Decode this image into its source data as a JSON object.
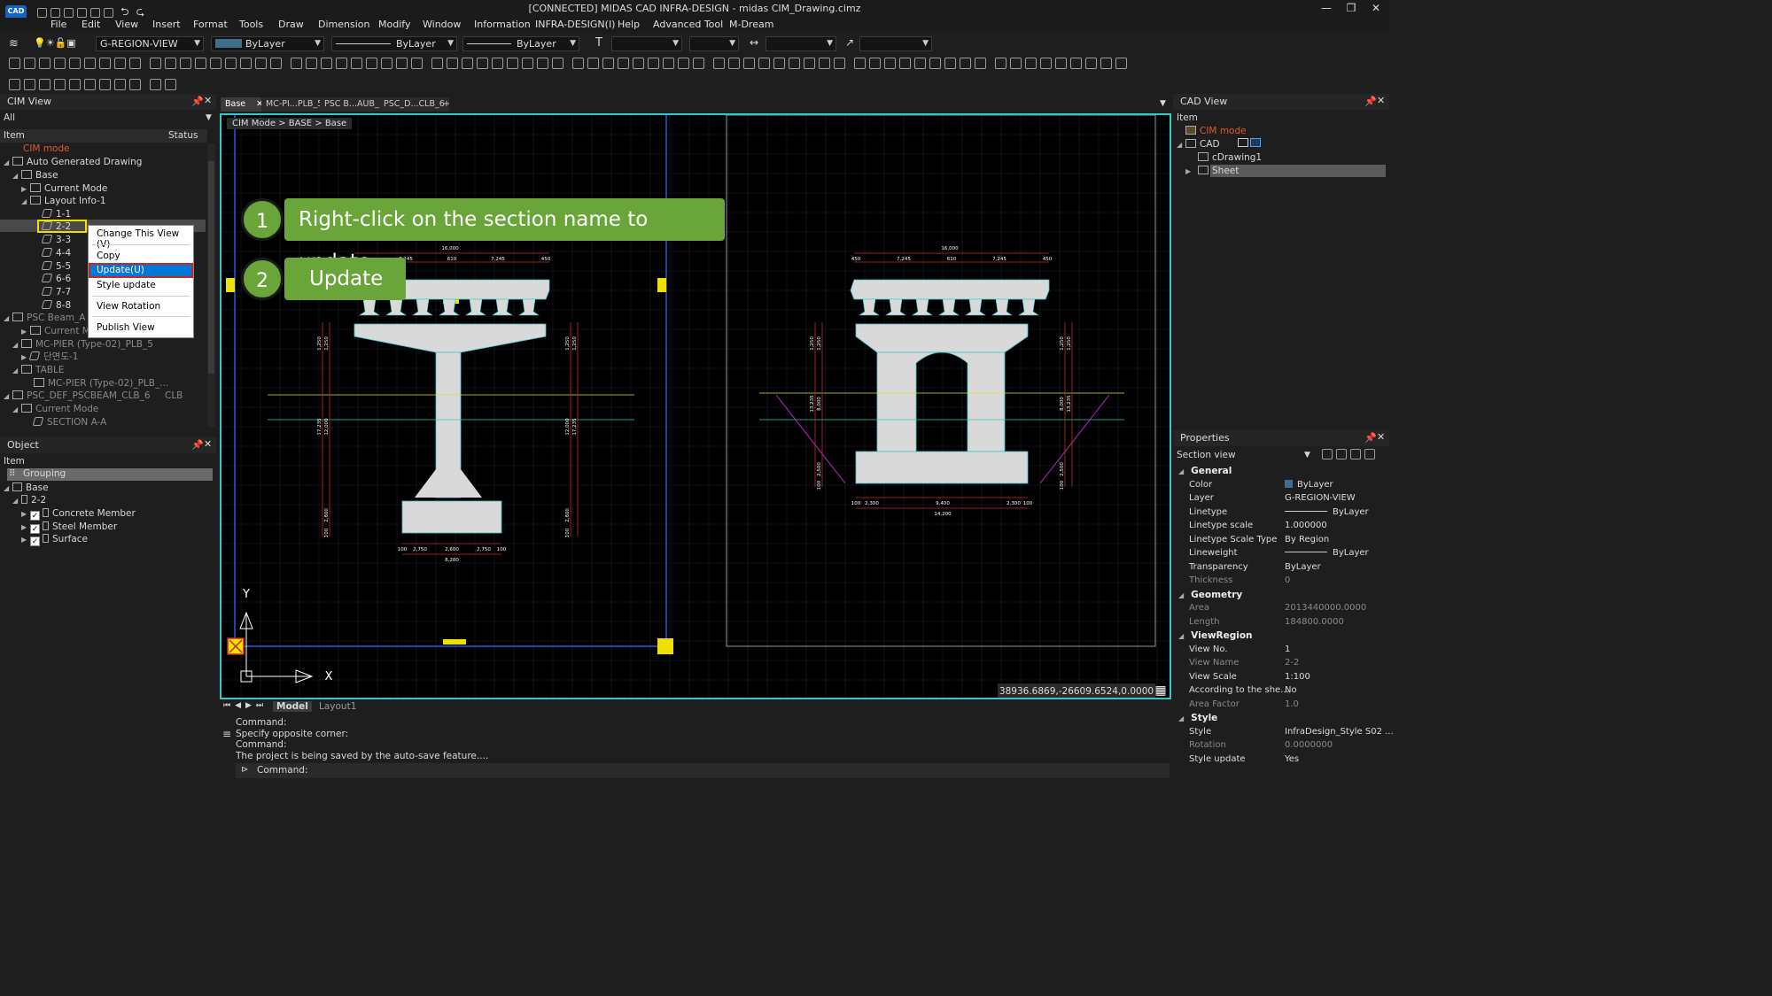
{
  "app": {
    "title": "[CONNECTED] MIDAS CAD INFRA-DESIGN - midas CIM_Drawing.cimz",
    "logo_text": "CAD",
    "window_controls": [
      "minimize-icon",
      "restore-icon",
      "close-icon"
    ]
  },
  "menu": [
    "File",
    "Edit",
    "View",
    "Insert",
    "Format",
    "Tools",
    "Draw",
    "Dimension",
    "Modify",
    "Window",
    "Information",
    "INFRA-DESIGN(I)",
    "Help",
    "Advanced Tool",
    "M-Dream"
  ],
  "toolbar": {
    "layer": "G-REGION-VIEW",
    "color": "ByLayer",
    "linetype": "ByLayer",
    "lineweight": "ByLayer",
    "layer_color": "#3e6f8a"
  },
  "cim_view": {
    "title": "CIM View",
    "filter": "All",
    "col_item": "Item",
    "col_status": "Status",
    "rows": [
      {
        "label": "CIM mode",
        "status": ""
      },
      {
        "label": "Auto Generated Drawing",
        "status": ""
      },
      {
        "label": "Base",
        "status": ""
      },
      {
        "label": "Current Mode",
        "status": ""
      },
      {
        "label": "Layout Info-1",
        "status": ""
      },
      {
        "label": "1-1",
        "status": ""
      },
      {
        "label": "2-2",
        "status": ""
      },
      {
        "label": "3-3",
        "status": ""
      },
      {
        "label": "4-4",
        "status": ""
      },
      {
        "label": "5-5",
        "status": ""
      },
      {
        "label": "6-6",
        "status": ""
      },
      {
        "label": "7-7",
        "status": ""
      },
      {
        "label": "8-8",
        "status": ""
      },
      {
        "label": "PSC Beam_A",
        "status": ""
      },
      {
        "label": "Current M",
        "status": ""
      },
      {
        "label": "MC-PIER (Type-02)_PLB_5",
        "status": ""
      },
      {
        "label": "단면도-1",
        "status": ""
      },
      {
        "label": "TABLE",
        "status": ""
      },
      {
        "label": "MC-PIER (Type-02)_PLB_...",
        "status": ""
      },
      {
        "label": "PSC_DEF_PSCBEAM_CLB_6",
        "status": "CLB"
      },
      {
        "label": "Current Mode",
        "status": ""
      },
      {
        "label": "SECTION A-A",
        "status": ""
      }
    ]
  },
  "context_menu": {
    "items": [
      "Change This View (V)",
      "Copy",
      "Update(U)",
      "Style update",
      "View Rotation",
      "Publish View"
    ]
  },
  "object_panel": {
    "title": "Object",
    "col_item": "Item",
    "rows": [
      "Grouping",
      "Base",
      "2-2",
      "Concrete Member",
      "Steel Member",
      "Surface"
    ]
  },
  "doc_tabs": [
    "Base",
    "MC-PI...PLB_5",
    "PSC B...AUB_2",
    "PSC_D...CLB_6"
  ],
  "breadcrumb": "CIM Mode > BASE > Base",
  "callouts": [
    {
      "num": "1",
      "text": "Right-click on the section name to update."
    },
    {
      "num": "2",
      "text": "Update"
    }
  ],
  "drawing": {
    "left_dims": {
      "top_total": "16,000",
      "top_segs": [
        "7,245",
        "610",
        "7,245",
        "450"
      ],
      "bottom": [
        "100",
        "2,750",
        "2,600",
        "2,750",
        "100"
      ],
      "bottom_total": "8,200",
      "vert_left": [
        "1,250",
        "1,250",
        "17,235",
        "12,000",
        "2,800",
        "100"
      ],
      "vert_right": [
        "1,250",
        "1,250",
        "12,000",
        "17,235",
        "2,800",
        "100"
      ]
    },
    "right_dims": {
      "top_total": "16,000",
      "top_segs": [
        "450",
        "7,245",
        "610",
        "7,245",
        "450"
      ],
      "bottom": [
        "100",
        "2,300",
        "9,400",
        "2,300",
        "100"
      ],
      "bottom_total": "14,200",
      "vert_left": [
        "1,250",
        "1,250",
        "13,235",
        "8,000",
        "2,500",
        "100"
      ],
      "vert_right": [
        "1,250",
        "1,250",
        "8,000",
        "13,235",
        "2,500",
        "100"
      ]
    },
    "axis_x": "X",
    "axis_y": "Y",
    "coords": "38936.6869,-26609.6524,0.0000"
  },
  "model_tabs": [
    "Model",
    "Layout1"
  ],
  "command": {
    "lines": [
      "Command:",
      "Specify opposite corner:",
      "Command:",
      "The project is being saved by the auto-save feature...."
    ],
    "prompt": "Command:"
  },
  "cad_view": {
    "title": "CAD View",
    "col_item": "Item",
    "rows": [
      "CIM mode",
      "CAD",
      "cDrawing1",
      "Sheet"
    ]
  },
  "properties": {
    "title": "Properties",
    "selector": "Section view",
    "categories": [
      {
        "name": "General",
        "rows": [
          {
            "k": "Color",
            "v": "ByLayer",
            "dim": false
          },
          {
            "k": "Layer",
            "v": "G-REGION-VIEW",
            "dim": false
          },
          {
            "k": "Linetype",
            "v": "ByLayer",
            "dim": false
          },
          {
            "k": "Linetype scale",
            "v": "1.000000",
            "dim": false
          },
          {
            "k": "Linetype Scale Type",
            "v": "By Region",
            "dim": false
          },
          {
            "k": "Lineweight",
            "v": "ByLayer",
            "dim": false
          },
          {
            "k": "Transparency",
            "v": "ByLayer",
            "dim": false
          },
          {
            "k": "Thickness",
            "v": "0",
            "dim": true
          }
        ]
      },
      {
        "name": "Geometry",
        "rows": [
          {
            "k": "Area",
            "v": "2013440000.0000",
            "dim": true
          },
          {
            "k": "Length",
            "v": "184800.0000",
            "dim": true
          }
        ]
      },
      {
        "name": "ViewRegion",
        "rows": [
          {
            "k": "View No.",
            "v": "1",
            "dim": false
          },
          {
            "k": "View Name",
            "v": "2-2",
            "dim": true
          },
          {
            "k": "View Scale",
            "v": "1:100",
            "dim": false
          },
          {
            "k": "According to the she...",
            "v": "No",
            "dim": false
          },
          {
            "k": "Area Factor",
            "v": "1.0",
            "dim": true
          }
        ]
      },
      {
        "name": "Style",
        "rows": [
          {
            "k": "Style",
            "v": "InfraDesign_Style S02 ...",
            "dim": false
          },
          {
            "k": "Rotation",
            "v": "0.0000000",
            "dim": true
          },
          {
            "k": "Style update",
            "v": "Yes",
            "dim": false
          }
        ]
      }
    ]
  },
  "colors": {
    "accent_cyan": "#39c6c9",
    "callout_green": "#6aa539",
    "highlight_red": "#c62828",
    "highlight_yellow": "#f0e000",
    "menu_select": "#0078d7"
  }
}
